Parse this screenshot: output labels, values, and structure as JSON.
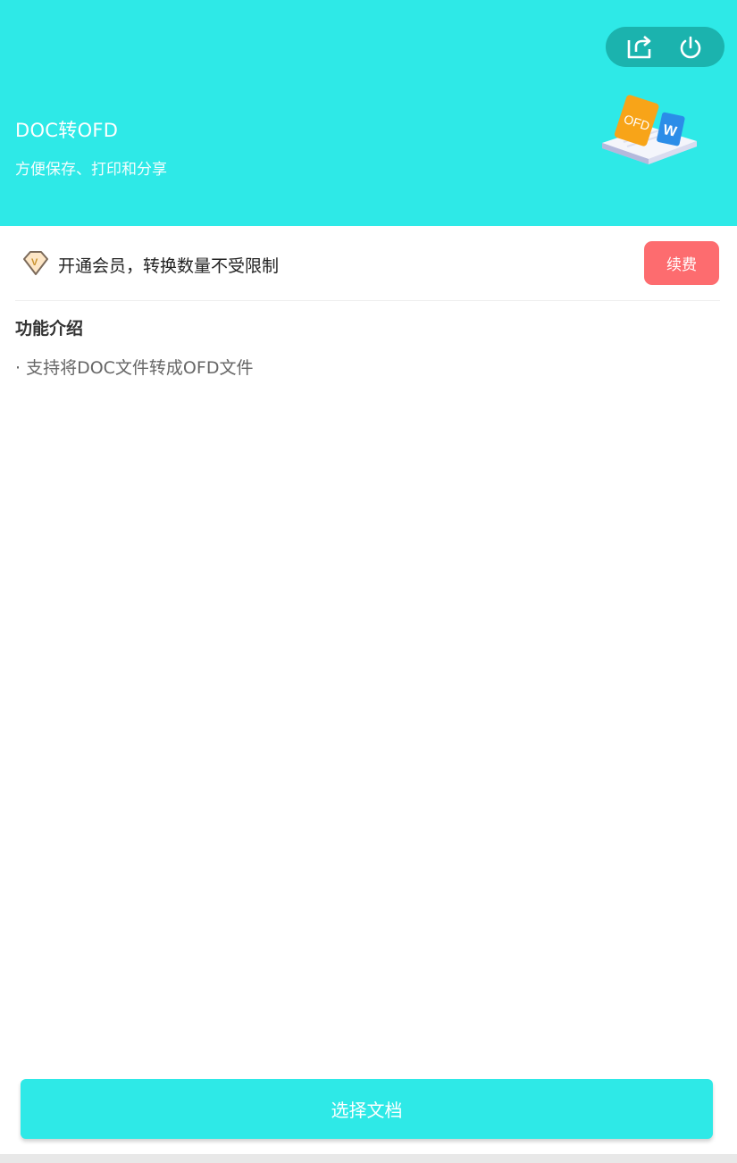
{
  "header": {
    "title": "DOC转OFD",
    "subtitle": "方便保存、打印和分享",
    "illustration_label_ofd": "OFD",
    "illustration_label_word": "W"
  },
  "actions": {
    "share_icon": "share-icon",
    "power_icon": "power-icon"
  },
  "membership": {
    "text": "开通会员，转换数量不受限制",
    "renew_label": "续费",
    "vip_badge": "V"
  },
  "features": {
    "title": "功能介绍",
    "items": [
      "· 支持将DOC文件转成OFD文件"
    ]
  },
  "bottom": {
    "select_label": "选择文档"
  },
  "colors": {
    "accent": "#2ee9e7",
    "pill": "#1bb3ae",
    "renew": "#fd6c6f"
  }
}
